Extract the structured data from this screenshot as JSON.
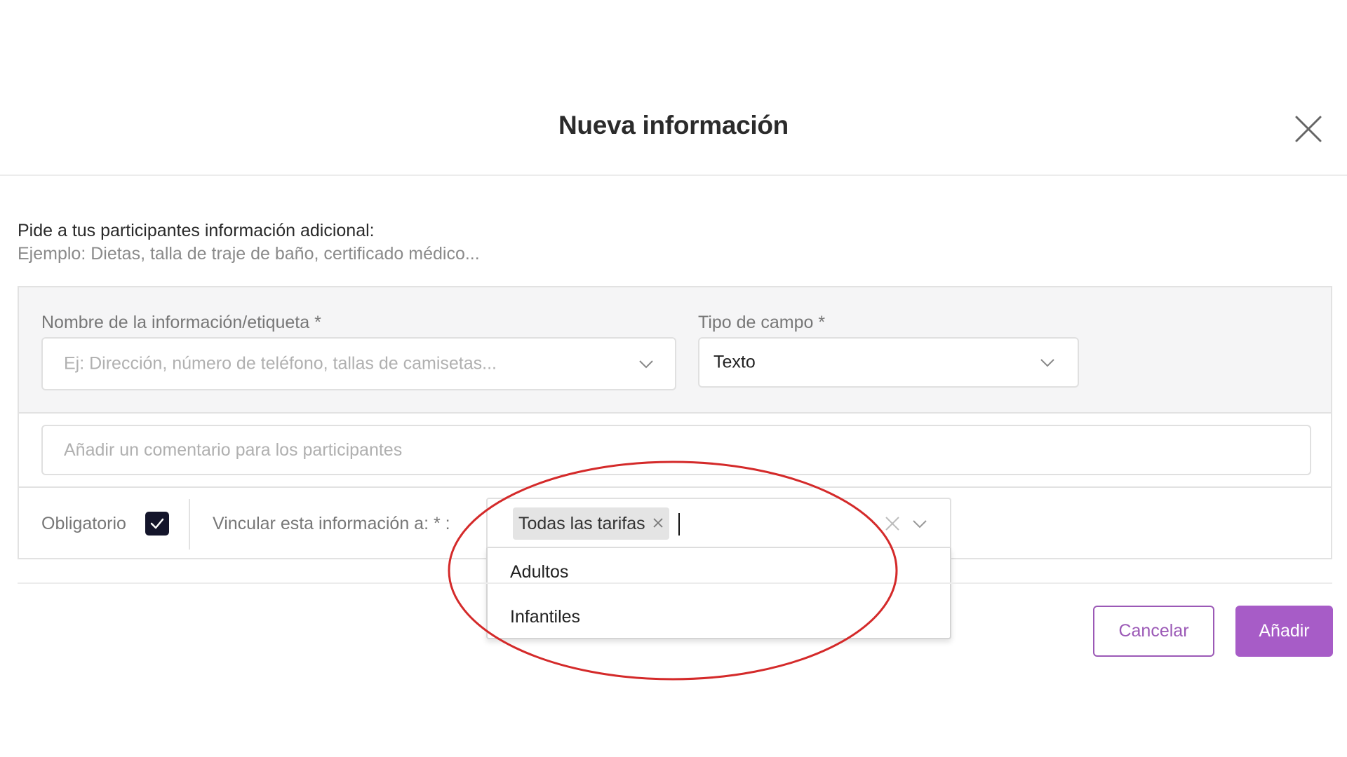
{
  "modal": {
    "title": "Nueva información",
    "intro": "Pide a tus participantes información adicional:",
    "example": "Ejemplo: Dietas, talla de traje de baño, certificado médico..."
  },
  "form": {
    "name_label": "Nombre de la información/etiqueta *",
    "name_placeholder": "Ej: Dirección, número de teléfono, tallas de camisetas...",
    "type_label": "Tipo de campo *",
    "type_value": "Texto",
    "comment_placeholder": "Añadir un comentario para los participantes",
    "required_label": "Obligatorio",
    "required_checked": true,
    "link_label": "Vincular esta información a: * :"
  },
  "link_select": {
    "selected_tags": [
      "Todas las tarifas"
    ],
    "options": [
      "Adultos",
      "Infantiles"
    ]
  },
  "actions": {
    "cancel": "Cancelar",
    "add": "Añadir"
  },
  "colors": {
    "accent": "#a75cc7",
    "accent_border": "#9b59b6",
    "checkbox": "#14152b",
    "annotation": "#d42a2a"
  },
  "icons": {
    "close": "close-icon",
    "chevron": "chevron-down-icon",
    "check": "check-icon",
    "tag_remove": "tag-remove-icon",
    "clear": "clear-icon"
  }
}
